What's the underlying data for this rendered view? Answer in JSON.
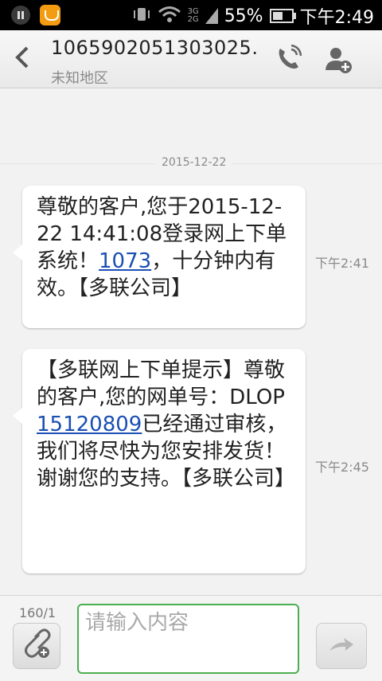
{
  "status_bar": {
    "battery_percent": "55%",
    "time": "下午2:49",
    "network_top": "3G",
    "network_bottom": "2G",
    "icons": [
      "pause-icon",
      "app-icon",
      "vibrate-icon",
      "wifi-icon",
      "signal-icon",
      "battery-icon"
    ]
  },
  "header": {
    "number": "1065902051303025.",
    "region": "未知地区",
    "icons": [
      "back-arrow-icon",
      "phone-call-icon",
      "add-contact-icon"
    ]
  },
  "conversation": {
    "date": "2015-12-22",
    "messages": [
      {
        "text_before": "尊敬的客户,您于2015-12-22 14:41:08登录网上下单系统！",
        "link": "1073",
        "text_after": "，十分钟内有效。【多联公司】",
        "time": "下午2:41"
      },
      {
        "text_before": "【多联网上下单提示】尊敬的客户,您的网单号：DLOP",
        "link": "15120809",
        "text_after": "已经通过审核，我们将尽快为您安排发货！谢谢您的支持。【多联公司】",
        "time": "下午2:45"
      }
    ]
  },
  "composer": {
    "counter": "160/1",
    "placeholder": "请输入内容",
    "value": "",
    "icons": [
      "attach-icon",
      "send-icon"
    ]
  },
  "colors": {
    "input_border": "#4caf50",
    "link": "#1a4fb4",
    "status_bar_bg": "#000000"
  }
}
